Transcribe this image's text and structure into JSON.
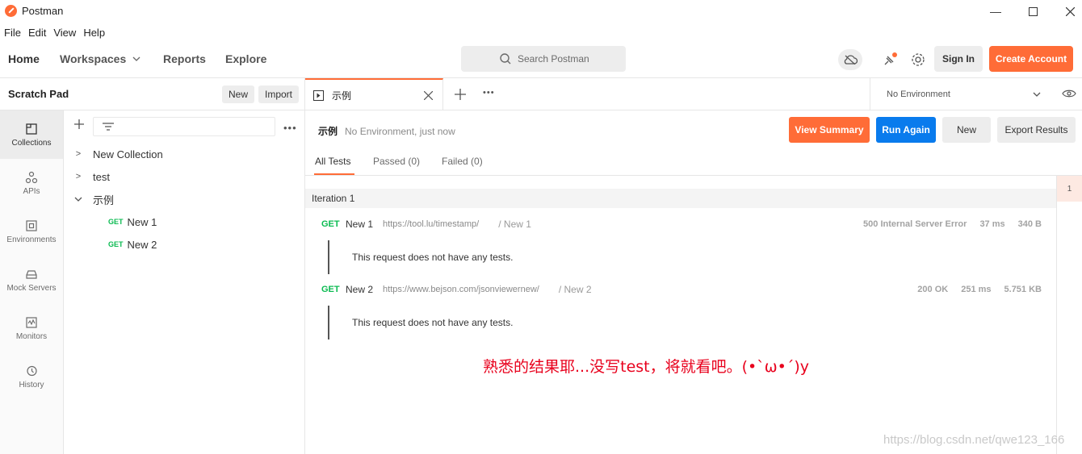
{
  "window": {
    "title": "Postman"
  },
  "menubar": [
    "File",
    "Edit",
    "View",
    "Help"
  ],
  "header": {
    "nav": {
      "home": "Home",
      "workspaces": "Workspaces",
      "reports": "Reports",
      "explore": "Explore"
    },
    "search_placeholder": "Search Postman",
    "sign_in": "Sign In",
    "create_account": "Create Account"
  },
  "workspace": {
    "title": "Scratch Pad",
    "new_label": "New",
    "import_label": "Import"
  },
  "sidebar": {
    "items": [
      {
        "label": "Collections",
        "icon": "collections-icon",
        "active": true
      },
      {
        "label": "APIs",
        "icon": "apis-icon"
      },
      {
        "label": "Environments",
        "icon": "environments-icon"
      },
      {
        "label": "Mock Servers",
        "icon": "mock-servers-icon"
      },
      {
        "label": "Monitors",
        "icon": "monitors-icon"
      },
      {
        "label": "History",
        "icon": "history-icon"
      }
    ]
  },
  "tree": {
    "collections": [
      "New Collection",
      "test",
      "示例"
    ],
    "requests": [
      {
        "method": "GET",
        "name": "New 1"
      },
      {
        "method": "GET",
        "name": "New 2"
      }
    ]
  },
  "tabs": {
    "active_tab": "示例",
    "environment": "No Environment"
  },
  "runner": {
    "name": "示例",
    "meta": "No Environment, just now",
    "view_summary": "View Summary",
    "run_again": "Run Again",
    "new_label": "New",
    "export_results": "Export Results",
    "result_tabs": {
      "all": "All Tests",
      "passed": "Passed (0)",
      "failed": "Failed (0)"
    },
    "iteration_label": "Iteration 1",
    "iteration_number": "1",
    "requests": [
      {
        "method": "GET",
        "name": "New 1",
        "url": "https://tool.lu/timestamp/",
        "path": "/ New 1",
        "status": "500 Internal Server Error",
        "time": "37 ms",
        "size": "340 B",
        "tests_message": "This request does not have any tests."
      },
      {
        "method": "GET",
        "name": "New 2",
        "url": "https://www.bejson.com/jsonviewernew/",
        "path": "/ New 2",
        "status": "200 OK",
        "time": "251 ms",
        "size": "5.751 KB",
        "tests_message": "This request does not have any tests."
      }
    ]
  },
  "annotation": "熟悉的结果耶...没写test，将就看吧。(•`ω•´)y",
  "watermark": "https://blog.csdn.net/qwe123_166",
  "colors": {
    "brand_orange": "#ff6c37",
    "run_blue": "#097bed",
    "get_green": "#0cbb52"
  }
}
